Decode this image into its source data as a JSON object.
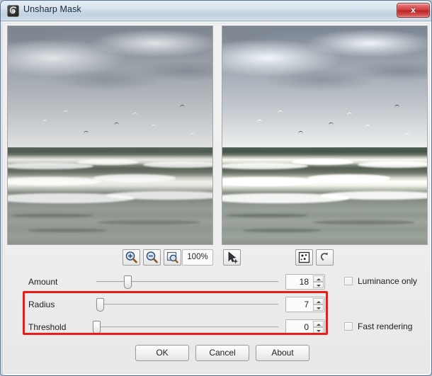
{
  "window": {
    "title": "Unsharp Mask",
    "icon": "plugin-swirl-icon",
    "close_label": "x"
  },
  "preview": {
    "left_pane_name": "original-preview",
    "right_pane_name": "filtered-preview",
    "scene": "seascape with cloudy sky, gulls and breaking waves"
  },
  "toolbar": {
    "zoom_in": "zoom-in-icon",
    "zoom_out": "zoom-out-icon",
    "zoom_fit": "zoom-fit-icon",
    "zoom_level": "100%",
    "pointer_tool": "pointer-add-icon",
    "preview_toggle": "preview-grain-icon",
    "reset": "reset-undo-icon"
  },
  "controls": [
    {
      "label": "Amount",
      "value": "18",
      "slider_pct": 17
    },
    {
      "label": "Radius",
      "value": "7",
      "slider_pct": 2
    },
    {
      "label": "Threshold",
      "value": "0",
      "slider_pct": 0
    }
  ],
  "options": [
    {
      "label": "Luminance only",
      "checked": false
    },
    {
      "label": "Fast rendering",
      "checked": false
    }
  ],
  "buttons": {
    "ok": "OK",
    "cancel": "Cancel",
    "about": "About"
  },
  "annotation": {
    "type": "highlight-rectangle",
    "color": "#ee1c17",
    "targets": [
      "Radius",
      "Threshold"
    ]
  }
}
